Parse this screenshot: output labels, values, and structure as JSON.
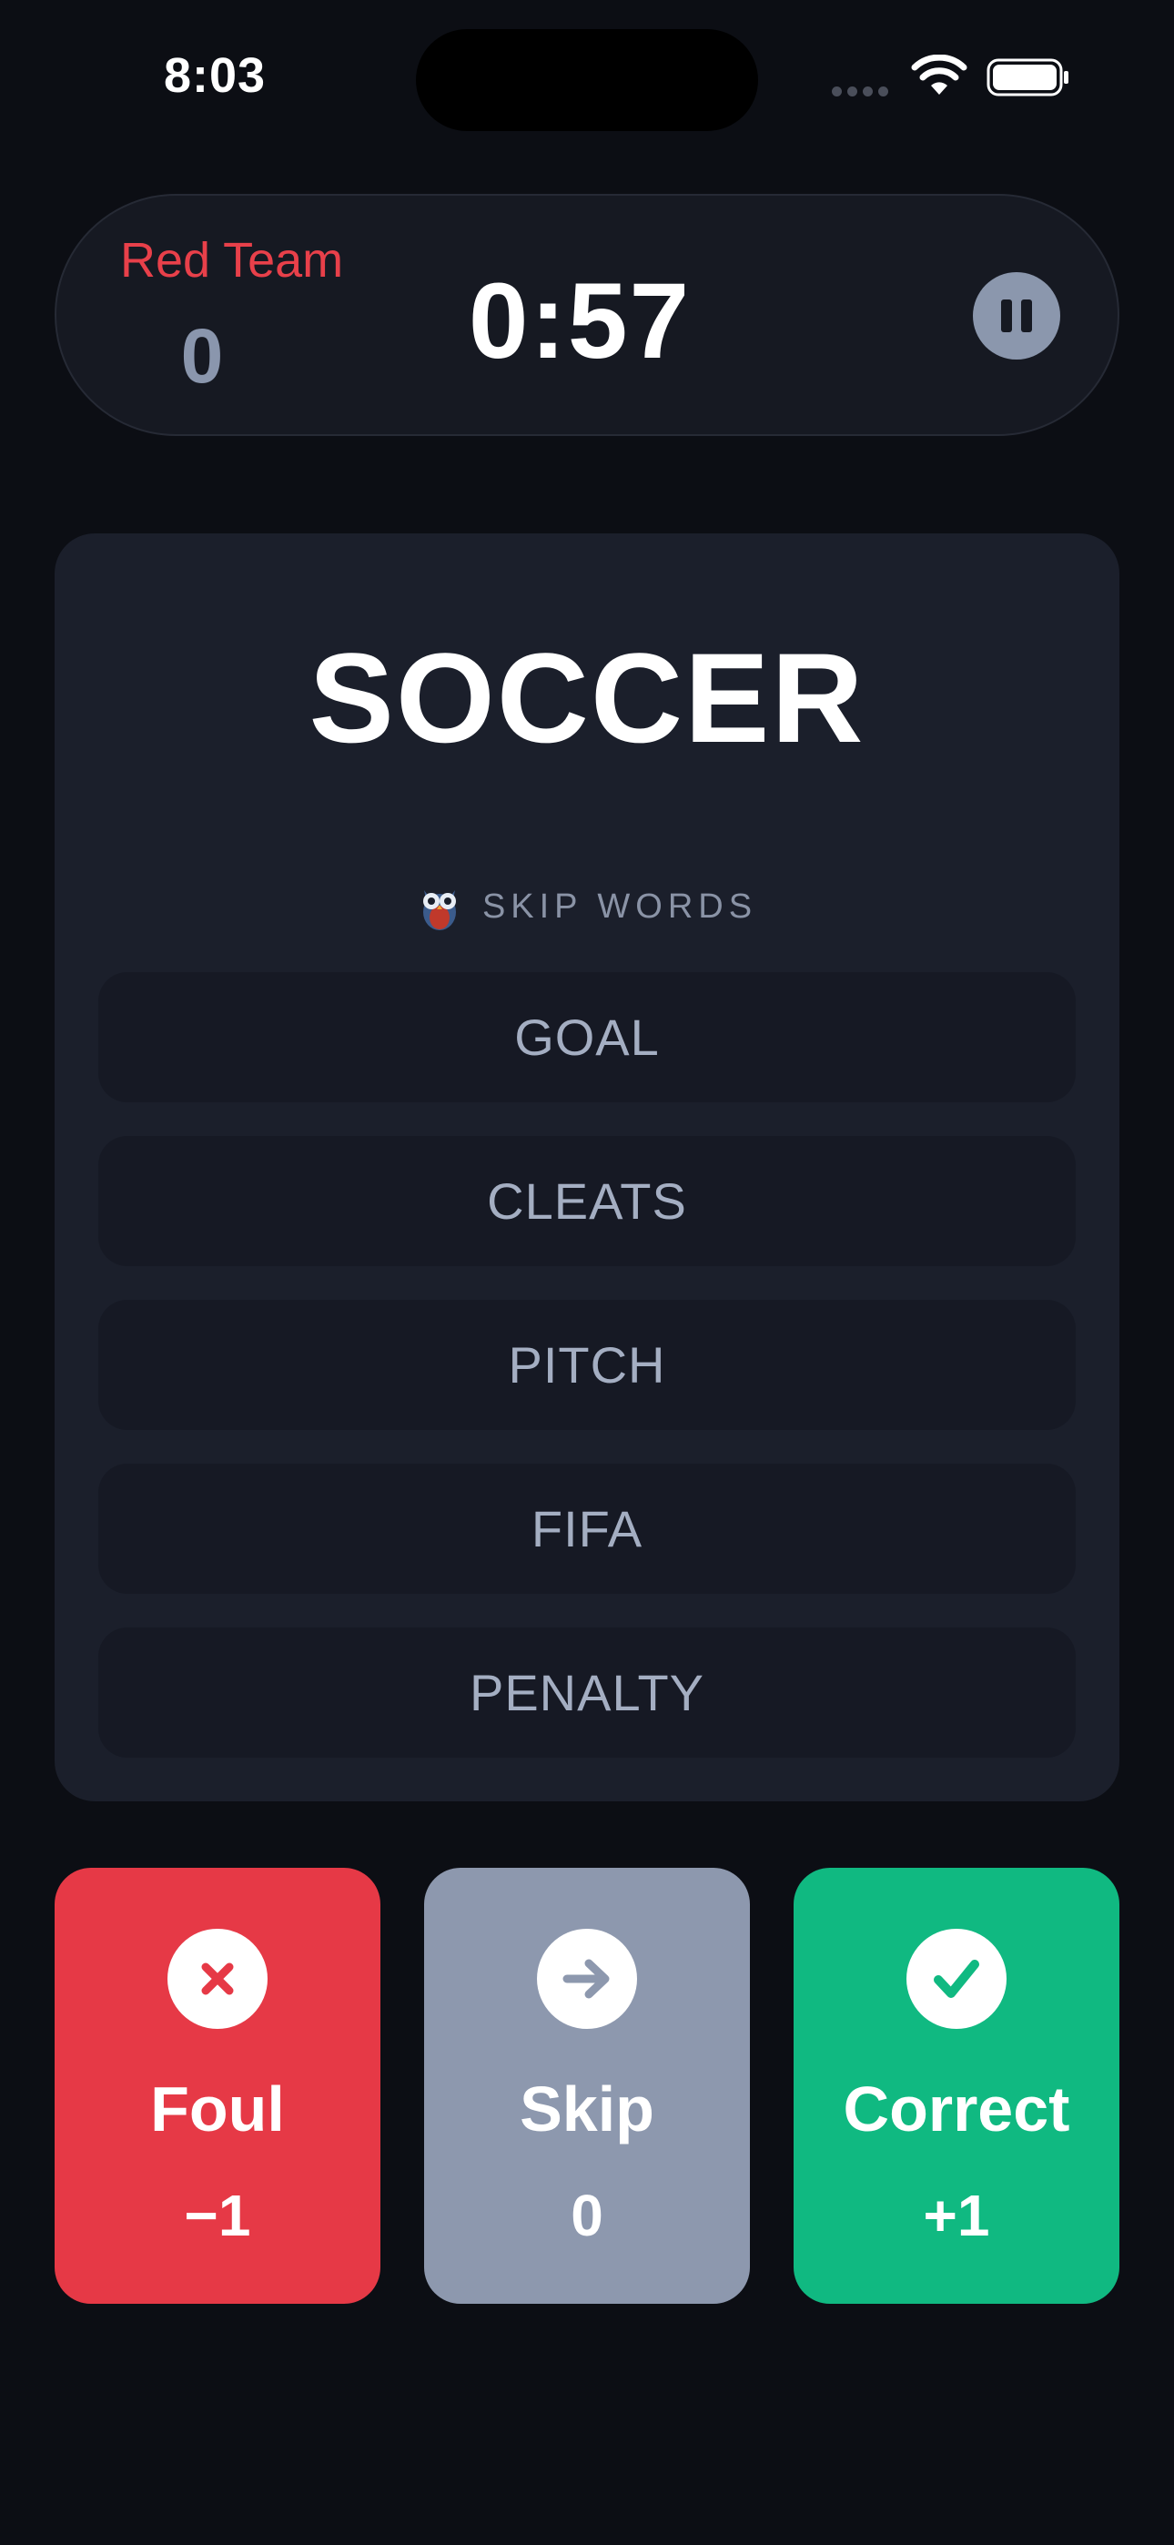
{
  "status_bar": {
    "time": "8:03"
  },
  "header": {
    "team_name": "Red Team",
    "team_score": "0",
    "timer": "0:57"
  },
  "card": {
    "main_word": "SOCCER",
    "skip_header": "SKIP WORDS",
    "skip_words": [
      "GOAL",
      "CLEATS",
      "PITCH",
      "FIFA",
      "PENALTY"
    ]
  },
  "actions": {
    "foul": {
      "label": "Foul",
      "value": "−1",
      "icon": "x-icon",
      "color": "#e63946"
    },
    "skip": {
      "label": "Skip",
      "value": "0",
      "icon": "arrow-right-icon",
      "color": "#8d98ae"
    },
    "correct": {
      "label": "Correct",
      "value": "+1",
      "icon": "check-icon",
      "color": "#10b981"
    }
  },
  "colors": {
    "background": "#0c0e14",
    "card": "#1b1f2b",
    "team_accent": "#e8404a"
  }
}
